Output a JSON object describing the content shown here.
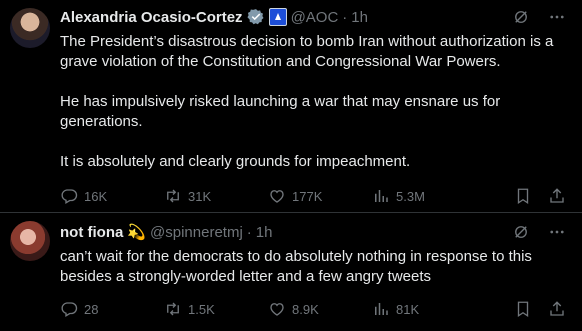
{
  "tweets": [
    {
      "name": "Alexandria Ocasio-Cortez",
      "handle": "@AOC",
      "time": "1h",
      "paragraphs": [
        "The President’s disastrous decision to bomb Iran without authorization is a grave violation of the Constitution and Congressional War Powers.",
        "He has impulsively risked launching a war that may ensnare us for generations.",
        "It is absolutely and clearly grounds for impeachment."
      ],
      "replies": "16K",
      "reposts": "31K",
      "likes": "177K",
      "views": "5.3M"
    },
    {
      "name": "not fiona",
      "emoji": "💫",
      "handle": "@spinneretmj",
      "time": "1h",
      "text": "can’t wait for the democrats to do absolutely nothing in response to this besides a strongly-worded letter and a few angry tweets",
      "replies": "28",
      "reposts": "1.5K",
      "likes": "8.9K",
      "views": "81K"
    }
  ],
  "separator": "·",
  "colors": {
    "background": "#000000",
    "text": "#e7e9ea",
    "muted": "#71767b",
    "verified": "#1d9bf0",
    "border": "#2f3336"
  },
  "icons": [
    "verified-badge-icon",
    "government-badge-icon",
    "grok-icon",
    "more-icon",
    "reply-icon",
    "repost-icon",
    "like-icon",
    "views-icon",
    "bookmark-icon",
    "share-icon"
  ]
}
